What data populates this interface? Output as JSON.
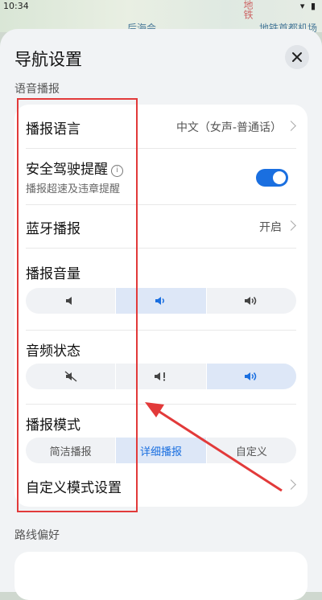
{
  "status_bar": {
    "time": "10:34",
    "right_icons": "▾ ▮"
  },
  "map": {
    "labels": [
      "后海会…",
      "地铁首都机场"
    ],
    "vertical_label": "地铁"
  },
  "header": {
    "title": "导航设置",
    "close_icon": "close-icon"
  },
  "voice_section": {
    "title": "语音播报",
    "broadcast_language": {
      "label": "播报语言",
      "value": "中文（女声-普通话）"
    },
    "safe_driving": {
      "label": "安全驾驶提醒",
      "sub": "播报超速及违章提醒",
      "enabled": true
    },
    "bluetooth": {
      "label": "蓝牙播报",
      "value": "开启"
    },
    "volume": {
      "label": "播报音量",
      "options": [
        "speaker-low-icon",
        "speaker-medium-icon",
        "speaker-high-icon"
      ],
      "selected_index": 1
    },
    "audio_state": {
      "label": "音频状态",
      "options": [
        "speaker-muted-icon",
        "speaker-alert-icon",
        "speaker-high-icon"
      ],
      "selected_index": 2
    },
    "broadcast_mode": {
      "label": "播报模式",
      "options": [
        "简洁播报",
        "详细播报",
        "自定义"
      ],
      "selected_index": 1
    },
    "custom_mode": {
      "label": "自定义模式设置"
    }
  },
  "route_section": {
    "title": "路线偏好"
  },
  "colors": {
    "accent": "#1a6fe0",
    "annotation": "#e23a3a"
  }
}
